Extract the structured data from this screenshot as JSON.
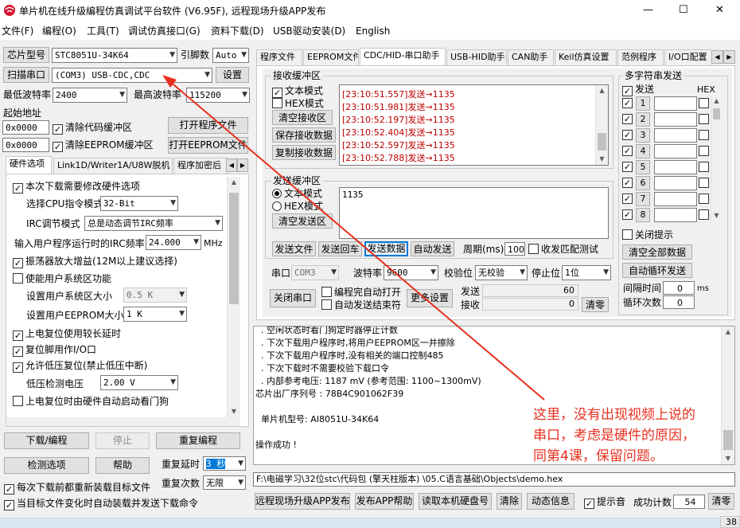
{
  "window": {
    "title": "单片机在线升级编程仿真调试平台软件 (V6.95F), 远程现场升级APP发布",
    "controls": [
      "—",
      "☐",
      "✕"
    ]
  },
  "menu": [
    "文件(F)",
    "编程(O)",
    "工具(T)",
    "调试仿真接口(G)",
    "资料下载(D)",
    "USB驱动安装(D)",
    "English"
  ],
  "left": {
    "chip_model_btn": "芯片型号",
    "chip_model": "STC8051U-34K64",
    "pin_count_label": "引脚数",
    "pin_count": "Auto",
    "scan_port_btn": "扫描串口",
    "port": "(COM3) USB-CDC,CDC",
    "settings_btn": "设置",
    "min_baud_label": "最低波特率",
    "min_baud": "2400",
    "max_baud_label": "最高波特率",
    "max_baud": "115200",
    "start_addr_label": "起始地址",
    "addr1": "0x0000",
    "clear_code_label": "清除代码缓冲区",
    "open_prog_btn": "打开程序文件",
    "addr2": "0x0000",
    "clear_eeprom_label": "清除EEPROM缓冲区",
    "open_eeprom_btn": "打开EEPROM文件",
    "tabs": [
      "硬件选项",
      "Link1D/Writer1A/U8W脱机",
      "程序加密后"
    ],
    "hw": {
      "reset_note": "本次下载需要修改硬件选项",
      "cpu_mode_label": "选择CPU指令模式",
      "cpu_mode": "32-Bit",
      "irc_mode_label": "IRC调节模式",
      "irc_mode": "总是动态调节IRC频率",
      "irc_freq_label": "输入用户程序运行时的IRC频率",
      "irc_freq": "24.000",
      "irc_unit": "MHz",
      "osc_gain": "振荡器放大增益(12M以上建议选择)",
      "user_sys_area": "使能用户系统区功能",
      "user_sys_size_label": "设置用户系统区大小",
      "user_sys_size": "0.5 K",
      "user_eeprom_label": "设置用户EEPROM大小",
      "user_eeprom": "1   K",
      "reset_delay": "上电复位使用较长延时",
      "reset_pin": "复位脚用作I/O口",
      "lvr": "允许低压复位(禁止低压中断)",
      "lvr_volt_label": "低压检测电压",
      "lvr_volt": "2.00 V",
      "wdt": "上电复位时由硬件自动启动看门狗"
    },
    "download_btn": "下载/编程",
    "stop_btn": "停止",
    "reprogram_btn": "重复编程",
    "detect_btn": "检测选项",
    "help_btn": "帮助",
    "repeat_delay_label": "重复延时",
    "repeat_delay": "3 秒",
    "repeat_count_label": "重复次数",
    "repeat_count": "无限",
    "reload_each": "每次下载前都重新装载目标文件",
    "auto_reload": "当目标文件变化时自动装载并发送下载命令"
  },
  "right": {
    "tabs": [
      "程序文件",
      "EEPROM文件",
      "CDC/HID-串口助手",
      "USB-HID助手",
      "CAN助手",
      "Keil仿真设置",
      "范例程序",
      "I/O口配置"
    ],
    "recv": {
      "title": "接收缓冲区",
      "text_mode": "文本模式",
      "hex_mode": "HEX模式",
      "clear_btn": "清空接收区",
      "save_btn": "保存接收数据",
      "copy_btn": "复制接收数据",
      "lines": [
        "[23:10:51.557]发送→1135",
        "[23:10:51.981]发送→1135",
        "[23:10:52.197]发送→1135",
        "[23:10:52.404]发送→1135",
        "[23:10:52.597]发送→1135",
        "[23:10:52.788]发送→1135"
      ]
    },
    "send": {
      "title": "发送缓冲区",
      "text_mode": "文本模式",
      "hex_mode": "HEX模式",
      "clear_btn": "清空发送区",
      "content": "1135",
      "send_file_btn": "发送文件",
      "send_cr_btn": "发送回车",
      "send_data_btn": "发送数据",
      "auto_send_btn": "自动发送",
      "period_label": "周期(ms)",
      "period": "100",
      "match_label": "收发匹配测试"
    },
    "serial": {
      "port_label": "串口",
      "port": "COM3",
      "baud_label": "波特率",
      "baud": "9600",
      "parity_label": "校验位",
      "parity": "无校验",
      "stop_label": "停止位",
      "stop": "1位",
      "close_btn": "关闭串口",
      "auto_open": "编程完自动打开",
      "auto_end": "自动发送结束符",
      "more_btn": "更多设置",
      "sent_label": "发送",
      "sent": "60",
      "recv_label": "接收",
      "recv": "0",
      "clear_btn": "清零"
    },
    "multi": {
      "title": "多字符串发送",
      "send_col": "发送",
      "hex_col": "HEX",
      "rows": [
        "1",
        "2",
        "3",
        "4",
        "5",
        "6",
        "7",
        "8"
      ],
      "close_hint": "关闭提示",
      "clear_all_btn": "清空全部数据",
      "auto_loop_btn": "自动循环发送",
      "interval_label": "间隔时间",
      "interval": "0",
      "interval_unit": "ms",
      "loop_label": "循环次数",
      "loop": "0"
    },
    "log": [
      "  . 空闲状态时看门狗定时器停止计数",
      "  . 下次下载用户程序时,将用户EEPROM区一并擦除",
      "  . 下次下载用户程序时,没有相关的端口控制485",
      "  . 下次下载时不需要校验下载口令",
      "  . 内部参考电压: 1187 mV (参考范围: 1100~1300mV)",
      "芯片出厂序列号 : 78B4C901062F39",
      "",
      "  单片机型号: AI8051U-34K64",
      "",
      "操作成功 !"
    ],
    "annotation": "这里，没有出现视频上说的\n串口，考虑是硬件的原因，\n同第4课，保留问题。",
    "filepath": "F:\\电磁学习\\32位stc\\代码包 (擎天柱版本) \\05.C语言基础\\Objects\\demo.hex"
  },
  "bottom": {
    "publish_btn": "远程现场升级APP发布",
    "app_help_btn": "发布APP帮助",
    "read_disk_btn": "读取本机硬盘号",
    "clear_btn": "清除",
    "anim_btn": "动态信息",
    "beep_label": "提示音",
    "success_label": "成功计数",
    "success": "54",
    "reset_btn": "清零"
  },
  "taskbar_num": "38",
  "colors": {
    "arrow": "#e8301f",
    "annotation": "#e8301f",
    "recv_text": "#c00000",
    "selected_field": "#0078d7"
  }
}
